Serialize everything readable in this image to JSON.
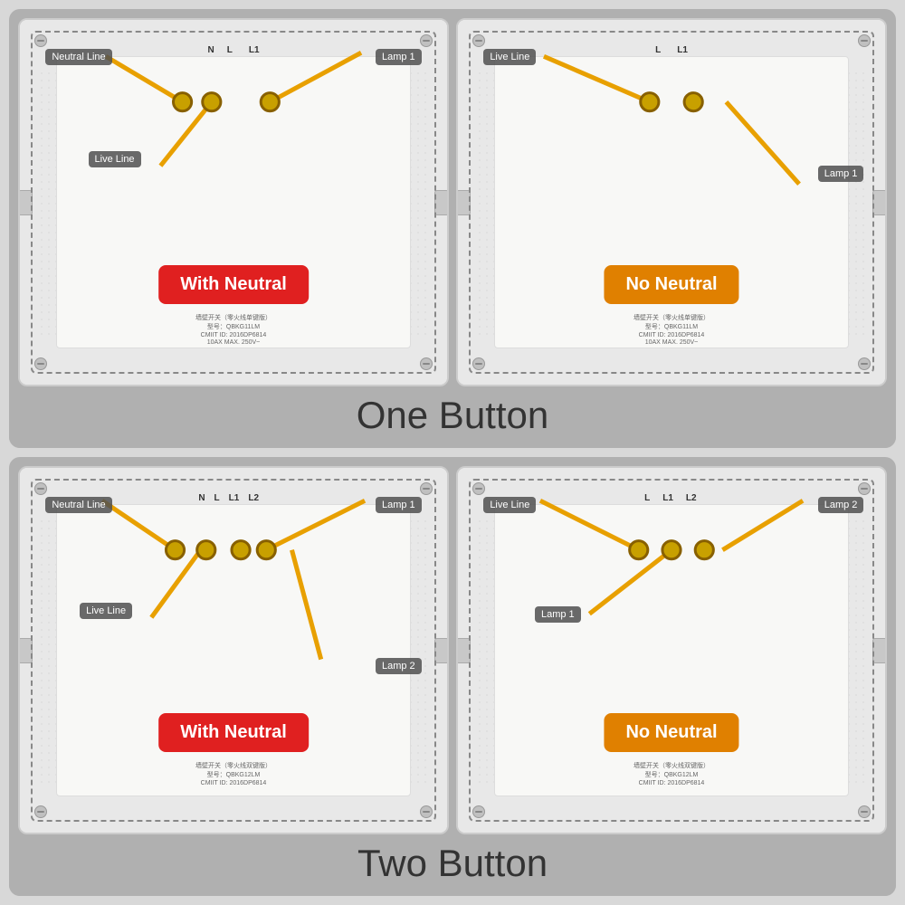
{
  "sections": [
    {
      "id": "one-button",
      "label": "One Button",
      "panels": [
        {
          "id": "one-with-neutral",
          "type": "with-neutral",
          "statusText": "With Neutral",
          "terminals": [
            "N",
            "L",
            "L1"
          ],
          "labels": [
            {
              "text": "Neutral Line",
              "top": "8%",
              "left": "6%"
            },
            {
              "text": "Lamp 1",
              "top": "8%",
              "right": "8%"
            },
            {
              "text": "Live Line",
              "top": "35%",
              "left": "18%"
            }
          ],
          "modelText": "型号：QBKG11LM",
          "certText": "CMIIT ID: 2016DP6814"
        },
        {
          "id": "one-no-neutral",
          "type": "no-neutral",
          "statusText": "No Neutral",
          "terminals": [
            "L",
            "L1"
          ],
          "labels": [
            {
              "text": "Live Line",
              "top": "8%",
              "left": "6%"
            },
            {
              "text": "Lamp 1",
              "top": "38%",
              "right": "6%"
            }
          ],
          "modelText": "型号：QBKG11LM",
          "certText": "CMIIT ID: 2016DP6814"
        }
      ]
    },
    {
      "id": "two-button",
      "label": "Two Button",
      "panels": [
        {
          "id": "two-with-neutral",
          "type": "with-neutral",
          "statusText": "With Neutral",
          "terminals": [
            "N",
            "L",
            "L1",
            "L2"
          ],
          "labels": [
            {
              "text": "Neutral Line",
              "top": "8%",
              "left": "6%"
            },
            {
              "text": "Lamp 1",
              "top": "8%",
              "right": "8%"
            },
            {
              "text": "Live Line",
              "top": "38%",
              "left": "16%"
            },
            {
              "text": "Lamp 2",
              "top": "52%",
              "right": "8%"
            }
          ],
          "modelText": "型号：QBKG12LM",
          "certText": "CMIIT ID: 2016DP6814"
        },
        {
          "id": "two-no-neutral",
          "type": "no-neutral",
          "statusText": "No Neutral",
          "terminals": [
            "L",
            "L1",
            "L2"
          ],
          "labels": [
            {
              "text": "Live Line",
              "top": "8%",
              "left": "6%"
            },
            {
              "text": "Lamp 2",
              "top": "8%",
              "right": "8%"
            },
            {
              "text": "Lamp 1",
              "top": "38%",
              "left": "20%"
            }
          ],
          "modelText": "型号：QBKG12LM",
          "certText": "CMIIT ID: 2016DP6814"
        }
      ]
    }
  ]
}
